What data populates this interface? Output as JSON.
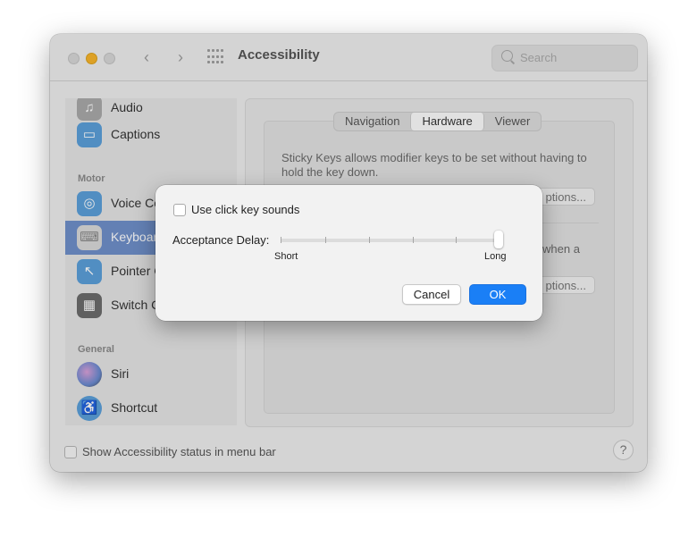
{
  "window": {
    "title": "Accessibility",
    "search_placeholder": "Search"
  },
  "sidebar": {
    "items": [
      {
        "label": "Audio",
        "icon": "speaker-icon"
      },
      {
        "label": "Captions",
        "icon": "captions-icon"
      },
      {
        "label": "Voice Co",
        "icon": "voice-control-icon"
      },
      {
        "label": "Keyboar",
        "icon": "keyboard-icon",
        "selected": true
      },
      {
        "label": "Pointer C",
        "icon": "pointer-icon"
      },
      {
        "label": "Switch C",
        "icon": "switch-control-icon"
      },
      {
        "label": "Siri",
        "icon": "siri-icon"
      },
      {
        "label": "Shortcut",
        "icon": "shortcut-icon"
      }
    ],
    "headers": {
      "motor": "Motor",
      "general": "General"
    }
  },
  "content": {
    "tabs": [
      "Navigation",
      "Hardware",
      "Viewer"
    ],
    "active_tab": "Hardware",
    "sticky_text": "Sticky Keys allows modifier keys to be set without having to hold the key down.",
    "options_fragment_1": "ptions...",
    "options_fragment_2": "ptions...",
    "when_fragment": "when a"
  },
  "bottom": {
    "status_label": "Show Accessibility status in menu bar",
    "help": "?"
  },
  "dialog": {
    "checkbox_label": "Use click key sounds",
    "delay_label": "Acceptance Delay:",
    "short_label": "Short",
    "long_label": "Long",
    "slider_value": 1.0,
    "cancel_label": "Cancel",
    "ok_label": "OK"
  },
  "colors": {
    "accent": "#1a7ff6",
    "selected_sidebar": "#6f8fc9",
    "yellow_light": "#f6b42b"
  }
}
